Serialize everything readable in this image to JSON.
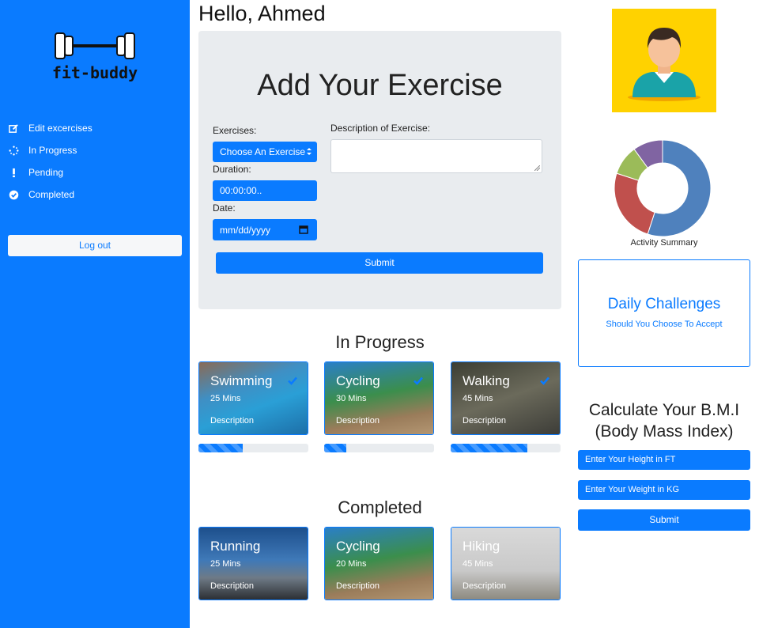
{
  "sidebar": {
    "logo_text": "fit-buddy",
    "items": [
      {
        "label": "Edit excercises",
        "icon": "edit-icon"
      },
      {
        "label": "In Progress",
        "icon": "spinner-icon"
      },
      {
        "label": "Pending",
        "icon": "exclamation-icon"
      },
      {
        "label": "Completed",
        "icon": "check-circle-icon"
      }
    ],
    "logout_label": "Log out"
  },
  "header": {
    "greeting": "Hello, Ahmed"
  },
  "form": {
    "title": "Add Your Exercise",
    "exercises_label": "Exercises:",
    "exercise_select_value": "Choose An Exercise",
    "duration_label": "Duration:",
    "duration_value": "00:00:00..",
    "date_label": "Date:",
    "date_value": "mm/dd/yyyy",
    "description_label": "Description of Exercise:",
    "submit_label": "Submit"
  },
  "in_progress": {
    "title": "In Progress",
    "cards": [
      {
        "name": "Swimming",
        "mins": "25 Mins",
        "desc": "Description",
        "progress": 0.4
      },
      {
        "name": "Cycling",
        "mins": "30 Mins",
        "desc": "Description",
        "progress": 0.2
      },
      {
        "name": "Walking",
        "mins": "45 Mins",
        "desc": "Description",
        "progress": 0.7
      }
    ]
  },
  "completed": {
    "title": "Completed",
    "cards": [
      {
        "name": "Running",
        "mins": "25 Mins",
        "desc": "Description"
      },
      {
        "name": "Cycling",
        "mins": "20 Mins",
        "desc": "Description"
      },
      {
        "name": "Hiking",
        "mins": "45 Mins",
        "desc": "Description"
      }
    ]
  },
  "activity": {
    "label": "Activity Summary",
    "segments": [
      {
        "value": 55,
        "color": "#4f81bd"
      },
      {
        "value": 25,
        "color": "#c0504d"
      },
      {
        "value": 10,
        "color": "#9bbb59"
      },
      {
        "value": 10,
        "color": "#8064a2"
      }
    ]
  },
  "challenges": {
    "title": "Daily Challenges",
    "subtitle": "Should You Choose To Accept"
  },
  "bmi": {
    "title_line1": "Calculate Your B.M.I",
    "title_line2": "(Body Mass Index)",
    "height_placeholder": "Enter Your Height in FT",
    "weight_placeholder": "Enter Your Weight in KG",
    "submit_label": "Submit"
  },
  "colors": {
    "accent": "#0a7bff",
    "avatar_bg": "#ffd200"
  }
}
